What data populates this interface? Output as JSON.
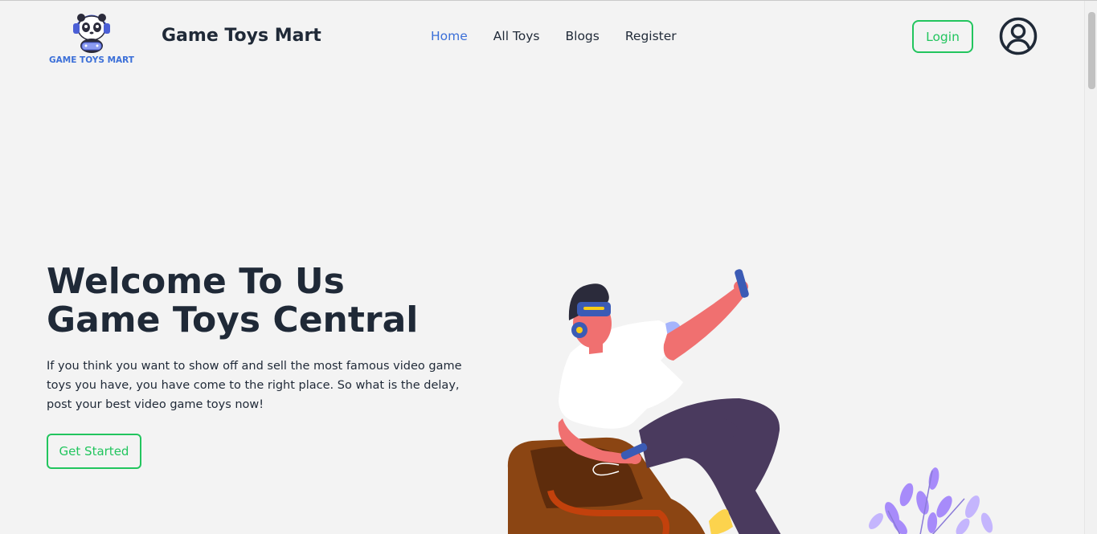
{
  "header": {
    "logo_text": "GAME TOYS MART",
    "brand": "Game Toys Mart",
    "nav": [
      {
        "label": "Home",
        "active": true
      },
      {
        "label": "All Toys",
        "active": false
      },
      {
        "label": "Blogs",
        "active": false
      },
      {
        "label": "Register",
        "active": false
      }
    ],
    "login_label": "Login"
  },
  "hero": {
    "title_line1": "Welcome To Us",
    "title_line2": "Game Toys Central",
    "description": "If you think you want to show off and sell the most famous video game toys you have, you have come to the right place. So what is the delay, post your best video game toys now!",
    "cta_label": "Get Started"
  },
  "colors": {
    "accent_green": "#22c55e",
    "active_blue": "#3b6fd8",
    "text_dark": "#1f2937",
    "background": "#f3f3f3"
  },
  "icons": {
    "logo": "panda-gamer-logo",
    "avatar": "user-circle-icon",
    "illustration": "vr-gamer-illustration"
  }
}
